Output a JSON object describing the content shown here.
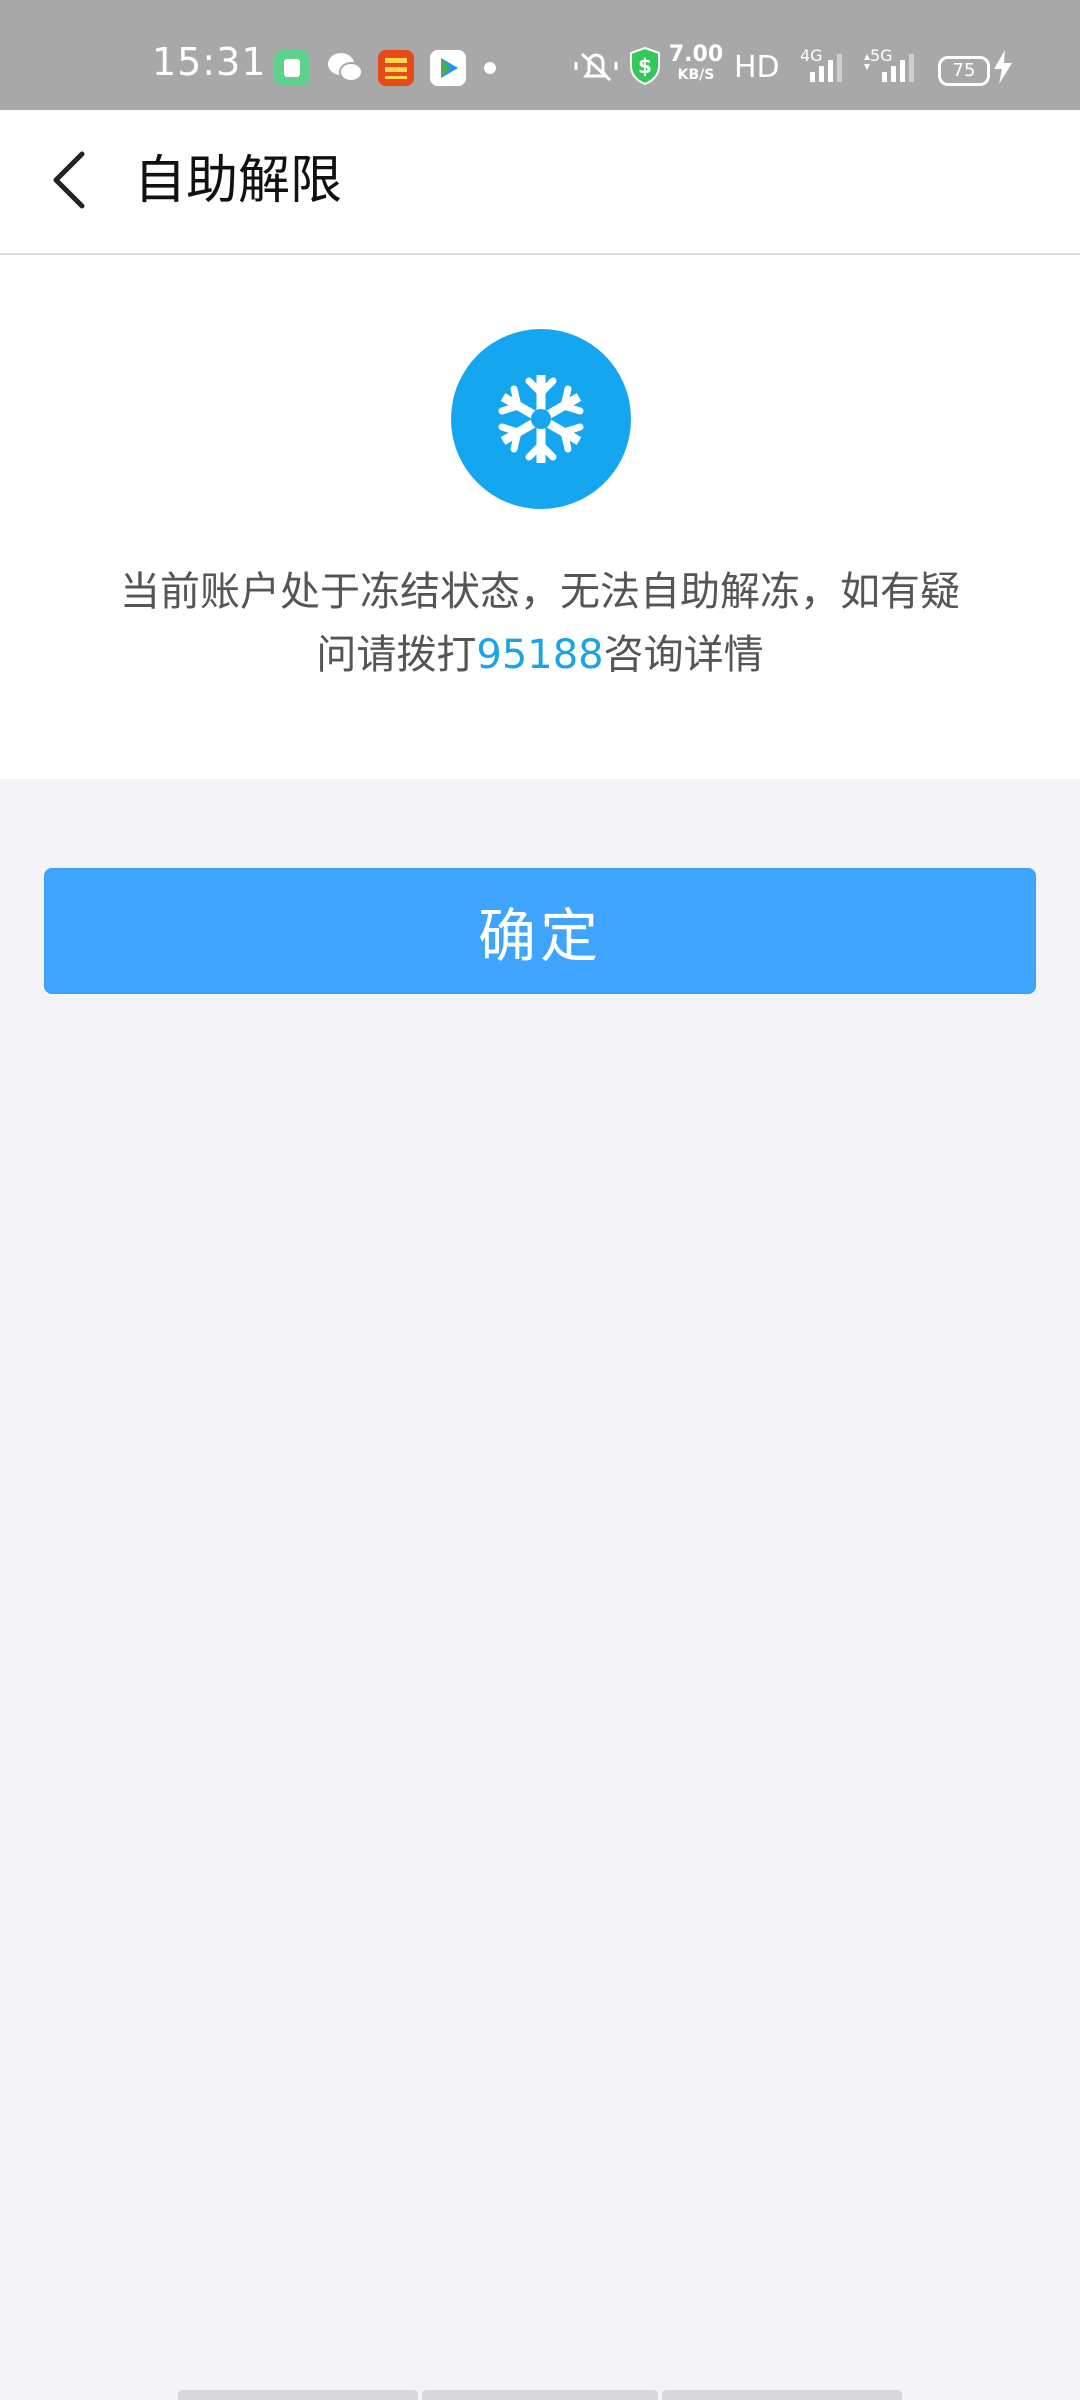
{
  "status_bar": {
    "time": "15:31",
    "net_speed_value": "7.00",
    "net_speed_unit": "KB/S",
    "hd": "HD",
    "signal_1": "4G",
    "signal_2": "5G",
    "battery": "75",
    "icons": [
      "green-app-icon",
      "wechat-icon",
      "pingan-bank-icon",
      "video-app-icon",
      "mute-icon",
      "shield-dollar-icon",
      "charging-icon"
    ]
  },
  "header": {
    "title": "自助解限",
    "back_icon": "chevron-left-icon"
  },
  "info": {
    "icon": "snowflake-icon",
    "icon_color": "#14a7ef",
    "message_part1": "当前账户处于冻结状态，无法自助解冻，如有疑问请拨打",
    "phone": "95188",
    "message_part2": "咨询详情",
    "link_color": "#19a3e8"
  },
  "actions": {
    "confirm_label": "确定",
    "confirm_color": "#3fa4fd"
  }
}
